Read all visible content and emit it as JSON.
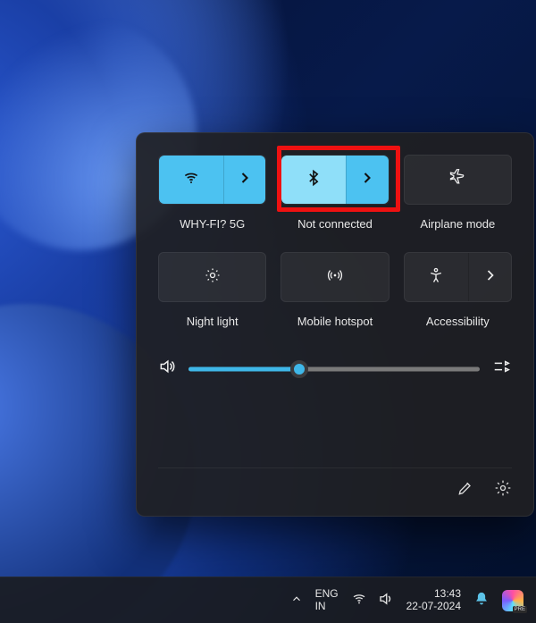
{
  "quick_settings": {
    "tiles": [
      {
        "id": "wifi",
        "label": "WHY-FI? 5G",
        "active": true,
        "split": true
      },
      {
        "id": "bluetooth",
        "label": "Not connected",
        "active": true,
        "split": true,
        "highlighted": true
      },
      {
        "id": "airplane",
        "label": "Airplane mode",
        "active": false,
        "split": false
      },
      {
        "id": "nightlight",
        "label": "Night light",
        "active": false,
        "split": false
      },
      {
        "id": "hotspot",
        "label": "Mobile hotspot",
        "active": false,
        "split": false
      },
      {
        "id": "accessibility",
        "label": "Accessibility",
        "active": false,
        "split": true
      }
    ],
    "volume_percent": 38
  },
  "taskbar": {
    "language_primary": "ENG",
    "language_secondary": "IN",
    "time": "13:43",
    "date": "22-07-2024",
    "copilot_badge": "PRE"
  }
}
